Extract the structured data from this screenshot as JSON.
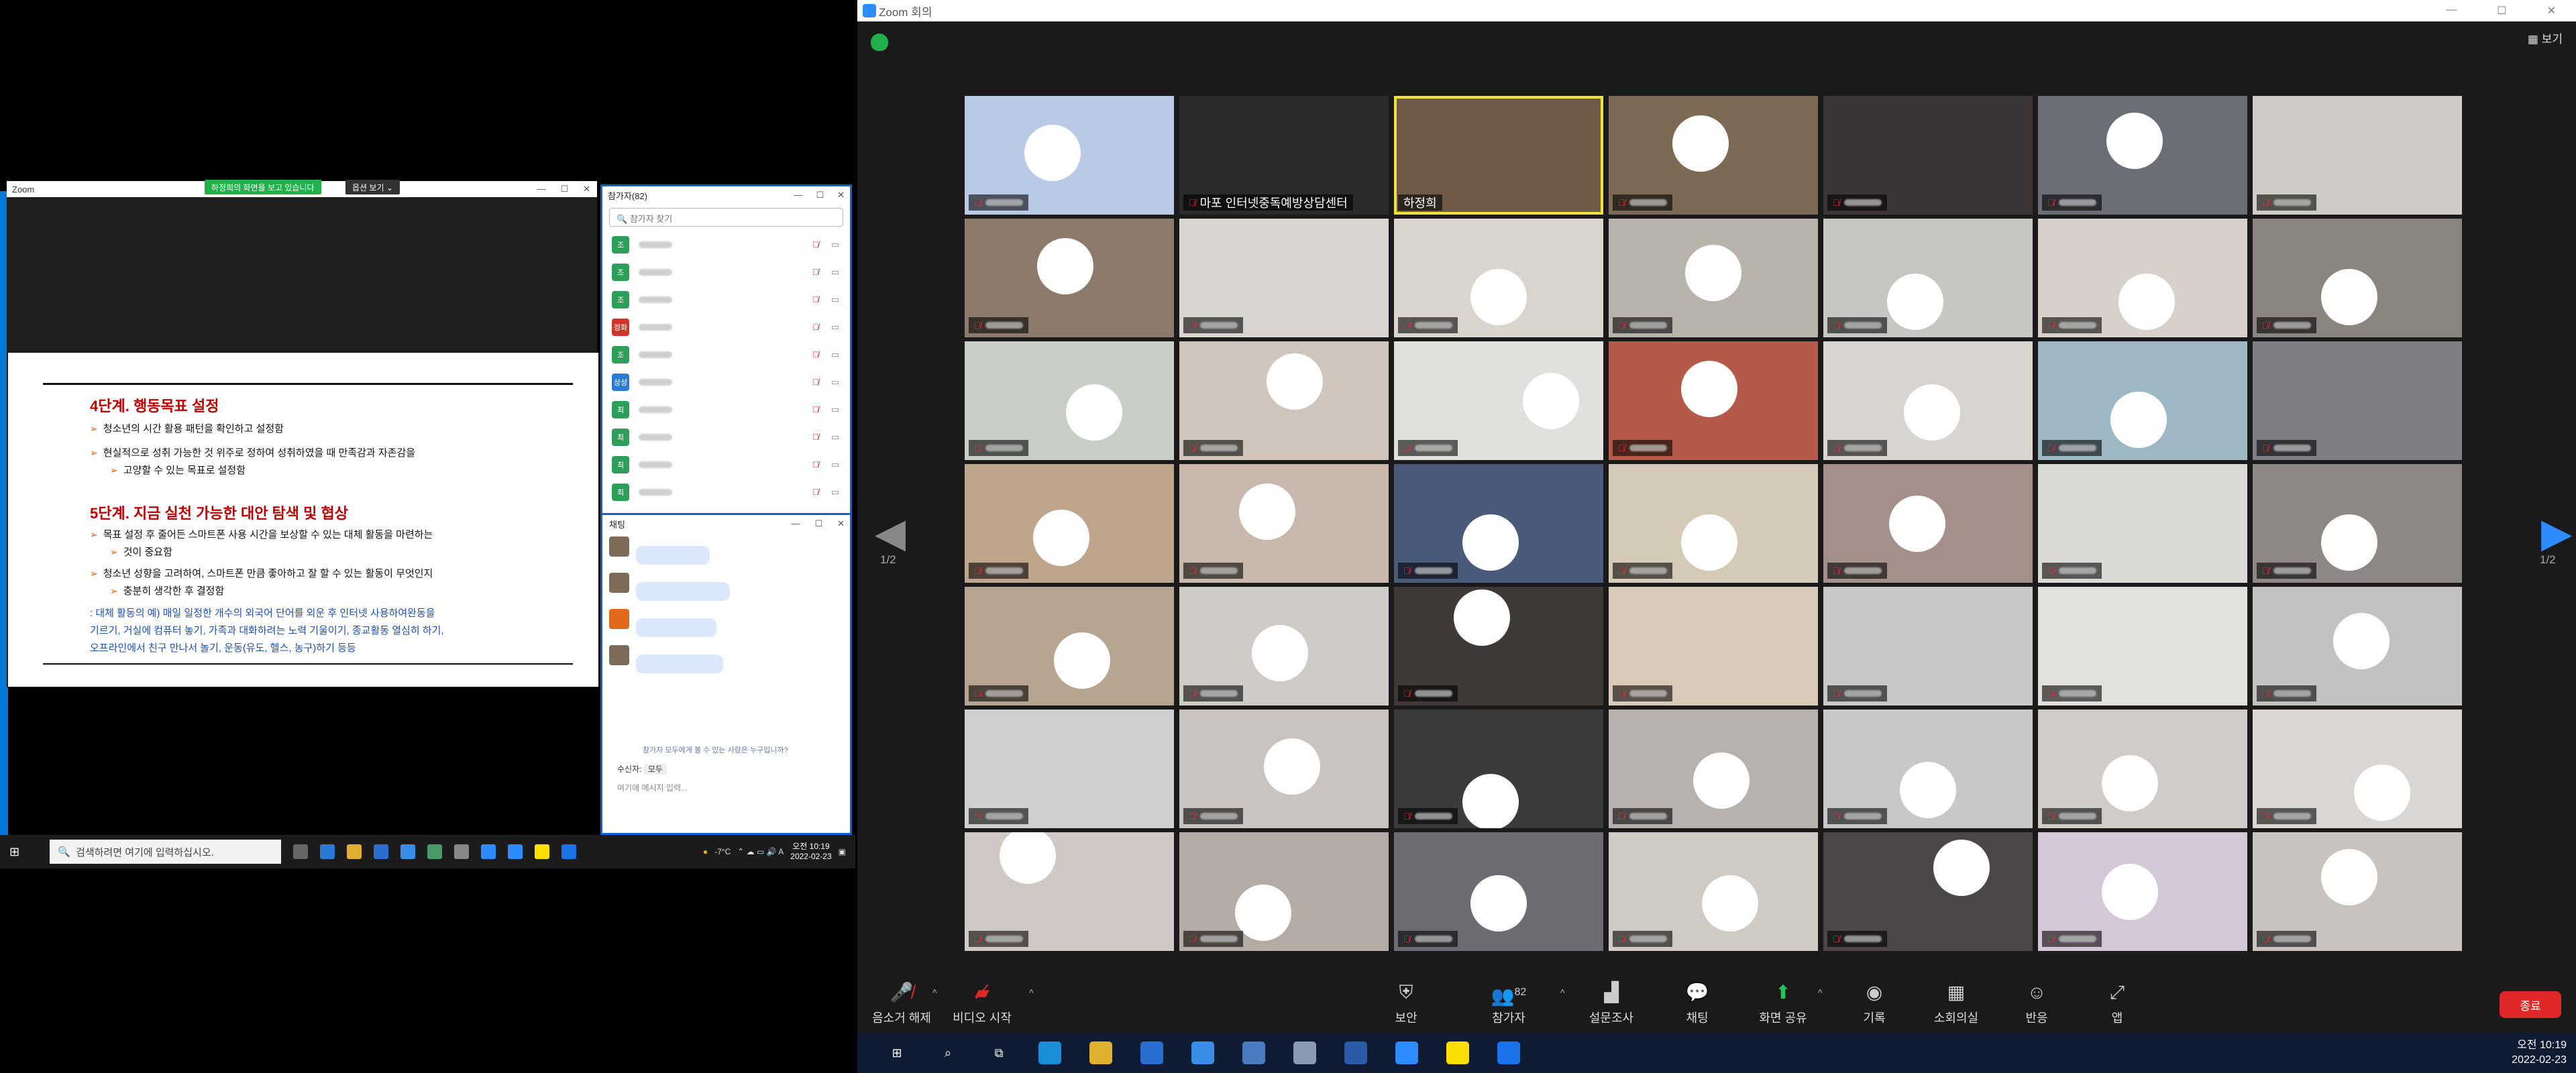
{
  "left_zoom": {
    "title": "Zoom",
    "share_banner": "하정희의 화면을 보고 있습니다",
    "view_options": "옵션 보기 ⌄",
    "slide": {
      "step4_title": "4단계. 행동목표 설정",
      "step4_bullets": [
        "청소년의 시간 활용 패턴을 확인하고 설정함",
        "현실적으로 성취 가능한 것 위주로 정하여 성취하였을 때 만족감과 자존감을",
        "고양할 수 있는 목표로 설정함"
      ],
      "step5_title": "5단계. 지금 실천 가능한 대안 탐색 및 협상",
      "step5_bullets": [
        "목표 설정 후 줄어든 스마트폰 사용 시간을 보상할 수 있는 대체 활동을 마련하는",
        "것이 중요함",
        "청소년 성향을 고려하여, 스마트폰 만큼 좋아하고 잘 할 수 있는 활동이 무엇인지",
        "충분히 생각한 후 결정함"
      ],
      "example_lines": [
        ": 대체 활동의 예) 매일 일정한 개수의 외국어 단어를 외운 후 인터넷 사용하여완동을",
        "기르기, 거실에 컴퓨터 놓기, 가족과 대화하려는 노력 기울이기, 종교활동 열심히 하기,",
        "오프라인에서 친구 만나서 놀기, 운동(유도, 헬스, 농구)하기 등등"
      ]
    }
  },
  "participants": {
    "title": "참가자(82)",
    "search_placeholder": "참가자 찾기",
    "rows": [
      {
        "avatar": "조",
        "color": "#2e9e5b"
      },
      {
        "avatar": "조",
        "color": "#2e9e5b"
      },
      {
        "avatar": "조",
        "color": "#2e9e5b"
      },
      {
        "avatar": "정화",
        "color": "#d0342c"
      },
      {
        "avatar": "조",
        "color": "#2e9e5b"
      },
      {
        "avatar": "상성",
        "color": "#2a7bd4"
      },
      {
        "avatar": "최",
        "color": "#2e9e5b"
      },
      {
        "avatar": "최",
        "color": "#2e9e5b"
      },
      {
        "avatar": "최",
        "color": "#2e9e5b"
      },
      {
        "avatar": "최",
        "color": "#2e9e5b"
      }
    ]
  },
  "chat": {
    "title": "채팅",
    "note": "참가자 모두에게 볼 수 있는 사람은 누구입니까?",
    "to_label": "수신자:",
    "to_value": "모두",
    "input_placeholder": "여기에 메시지 입력..."
  },
  "left_taskbar": {
    "search_placeholder": "검색하려면 여기에 입력하십시오.",
    "temperature": "-7°C",
    "time": "오전 10:19",
    "date": "2022-02-23"
  },
  "zoom": {
    "window_title": "Zoom 회의",
    "view_button": "보기",
    "page_left": "1/2",
    "page_right": "1/2",
    "tiles": [
      {
        "name": "",
        "bg": "#b9c9e6",
        "face": [
          42,
          48
        ],
        "blurname": true
      },
      {
        "name": "마포 인터넷중독예방상담센터",
        "bg": "#2a2a2a",
        "face": null,
        "blurname": false
      },
      {
        "name": "하정희",
        "bg": "#6f5a4a",
        "face": null,
        "blurname": false,
        "active": true
      },
      {
        "name": "",
        "bg": "#7c6a55",
        "face": [
          44,
          40
        ],
        "blurname": true
      },
      {
        "name": "",
        "bg": "#3b3536",
        "face": null,
        "blurname": true
      },
      {
        "name": "",
        "bg": "#6b6e76",
        "face": [
          46,
          38
        ],
        "blurname": true
      },
      {
        "name": "",
        "bg": "#cfcbc6",
        "face": null,
        "blurname": true
      },
      {
        "name": "",
        "bg": "#8c7a6c",
        "face": [
          48,
          40
        ],
        "blurname": true
      },
      {
        "name": "",
        "bg": "#d8d4cf",
        "face": null,
        "blurname": true
      },
      {
        "name": "",
        "bg": "#d9d4cd",
        "face": [
          50,
          66
        ],
        "blurname": true
      },
      {
        "name": "",
        "bg": "#b8b3ab",
        "face": [
          50,
          46
        ],
        "blurname": true
      },
      {
        "name": "",
        "bg": "#c7c6c2",
        "face": [
          44,
          70
        ],
        "blurname": true
      },
      {
        "name": "",
        "bg": "#d7d1ca",
        "face": [
          52,
          70
        ],
        "blurname": true
      },
      {
        "name": "",
        "bg": "#8b8580",
        "face": [
          46,
          66
        ],
        "blurname": true
      },
      {
        "name": "",
        "bg": "#c9cec6",
        "face": [
          62,
          60
        ],
        "blurname": true
      },
      {
        "name": "",
        "bg": "#cfc5bc",
        "face": [
          55,
          34
        ],
        "blurname": true
      },
      {
        "name": "",
        "bg": "#e2e0dd",
        "face": [
          75,
          50
        ],
        "blurname": true
      },
      {
        "name": "",
        "bg": "#b55a48",
        "face": [
          48,
          40
        ],
        "blurname": true
      },
      {
        "name": "",
        "bg": "#d8d4d0",
        "face": [
          52,
          60
        ],
        "blurname": true
      },
      {
        "name": "",
        "bg": "#9fb8c6",
        "face": [
          48,
          66
        ],
        "blurname": true
      },
      {
        "name": "",
        "bg": "#7e7f84",
        "face": null,
        "blurname": true
      },
      {
        "name": "",
        "bg": "#bfa58c",
        "face": [
          46,
          62
        ],
        "blurname": true
      },
      {
        "name": "",
        "bg": "#c9b9ad",
        "face": [
          42,
          40
        ],
        "blurname": true
      },
      {
        "name": "",
        "bg": "#4a5a7a",
        "face": [
          46,
          66
        ],
        "blurname": true
      },
      {
        "name": "",
        "bg": "#d4cab7",
        "face": [
          48,
          66
        ],
        "blurname": true
      },
      {
        "name": "",
        "bg": "#a4908a",
        "face": [
          45,
          50
        ],
        "blurname": true
      },
      {
        "name": "",
        "bg": "#dcdad7",
        "face": null,
        "blurname": true
      },
      {
        "name": "",
        "bg": "#8d8886",
        "face": [
          46,
          66
        ],
        "blurname": true
      },
      {
        "name": "",
        "bg": "#b5a591",
        "face": [
          56,
          62
        ],
        "blurname": true
      },
      {
        "name": "",
        "bg": "#cfccc8",
        "face": [
          48,
          56
        ],
        "blurname": true
      },
      {
        "name": "",
        "bg": "#3f3a37",
        "face": [
          42,
          26
        ],
        "blurname": true
      },
      {
        "name": "",
        "bg": "#d9cbb9",
        "face": null,
        "blurname": true
      },
      {
        "name": "",
        "bg": "#c7c9c7",
        "face": null,
        "blurname": true
      },
      {
        "name": "",
        "bg": "#e3e1de",
        "face": null,
        "blurname": true
      },
      {
        "name": "",
        "bg": "#c4c2c0",
        "face": [
          52,
          46
        ],
        "blurname": true
      },
      {
        "name": "",
        "bg": "#cfcfd0",
        "face": null,
        "blurname": true
      },
      {
        "name": "",
        "bg": "#c9c4bf",
        "face": [
          54,
          48
        ],
        "blurname": true
      },
      {
        "name": "",
        "bg": "#3a3b3b",
        "face": [
          46,
          78
        ],
        "blurname": true
      },
      {
        "name": "",
        "bg": "#b7b2ad",
        "face": [
          54,
          60
        ],
        "blurname": true
      },
      {
        "name": "",
        "bg": "#c8c7c9",
        "face": [
          50,
          68
        ],
        "blurname": true
      },
      {
        "name": "",
        "bg": "#cfccc9",
        "face": [
          44,
          62
        ],
        "blurname": true
      },
      {
        "name": "",
        "bg": "#d9d6d3",
        "face": [
          62,
          70
        ],
        "blurname": true
      },
      {
        "name": "",
        "bg": "#cfc8c4",
        "face": [
          30,
          20
        ],
        "blurname": true
      },
      {
        "name": "",
        "bg": "#b4aca4",
        "face": [
          40,
          68
        ],
        "blurname": true
      },
      {
        "name": "",
        "bg": "#6f6b72",
        "face": [
          50,
          60
        ],
        "blurname": true
      },
      {
        "name": "",
        "bg": "#cfcac4",
        "face": [
          58,
          60
        ],
        "blurname": true
      },
      {
        "name": "",
        "bg": "#4a4746",
        "face": [
          66,
          30
        ],
        "blurname": true
      },
      {
        "name": "",
        "bg": "#d4c7d8",
        "face": [
          44,
          50
        ],
        "blurname": true
      },
      {
        "name": "",
        "bg": "#c9c3bf",
        "face": [
          46,
          38
        ],
        "blurname": true
      }
    ],
    "toolbar": {
      "unmute": "음소거 해제",
      "start_video": "비디오 시작",
      "security": "보안",
      "participants": "참가자",
      "participants_count": "82",
      "polls": "설문조사",
      "chat": "채팅",
      "share_screen": "화면 공유",
      "record": "기록",
      "breakout": "소회의실",
      "reactions": "반응",
      "apps": "앱",
      "end": "종료"
    },
    "taskbar": {
      "time": "오전 10:19",
      "date": "2022-02-23"
    }
  }
}
